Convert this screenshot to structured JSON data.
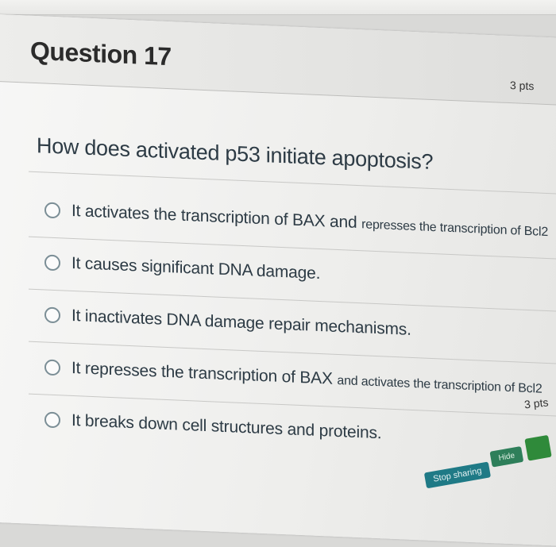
{
  "question": {
    "title": "Question 17",
    "points": "3 pts",
    "text": "How does activated p53 initiate apoptosis?"
  },
  "answers": [
    {
      "main": "It activates the transcription of BAX and ",
      "small": "represses the transcription of Bcl2"
    },
    {
      "main": "It causes significant DNA damage.",
      "small": ""
    },
    {
      "main": "It inactivates DNA damage repair mechanisms.",
      "small": ""
    },
    {
      "main": "It represses the transcription of BAX ",
      "small": "and activates the transcription of Bcl2"
    },
    {
      "main": "It breaks down cell structures and proteins.",
      "small": ""
    }
  ],
  "next_question": {
    "points": "3 pts"
  },
  "screen_share": {
    "stop_label": "Stop sharing",
    "hide_label": "Hide"
  },
  "colors": {
    "radio_border": "#7b8e96",
    "text": "#2d3b45",
    "share_bar": "#1f7a86"
  }
}
